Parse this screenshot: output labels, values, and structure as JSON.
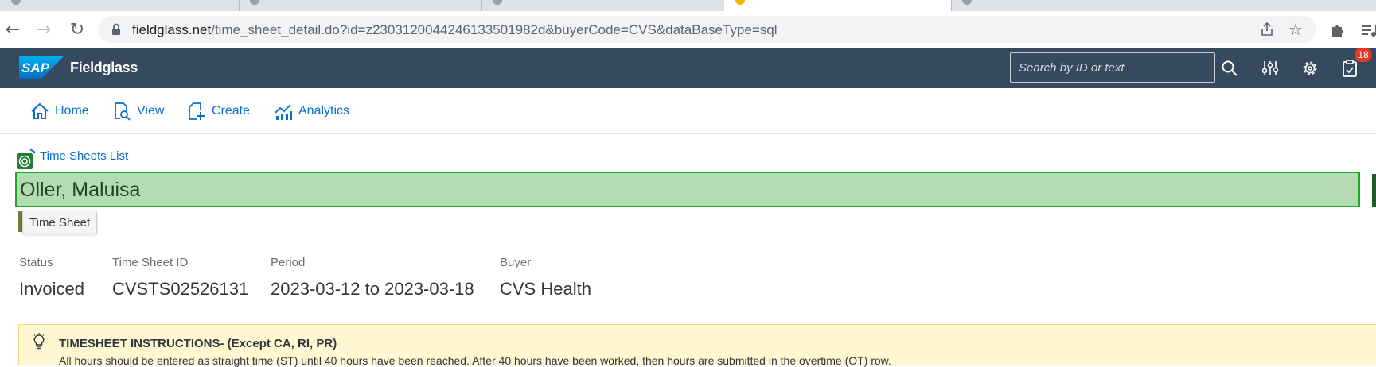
{
  "browser": {
    "url_host": "fieldglass.net",
    "url_path": "/time_sheet_detail.do?id=z2303120044246133501982d&buyerCode=CVS&dataBaseType=sql"
  },
  "shell": {
    "logo_text": "SAP",
    "product_name": "Fieldglass",
    "search_placeholder": "Search by ID or text",
    "notification_count": "18",
    "icons": [
      "search-icon",
      "filter-sliders-icon",
      "gear-icon",
      "clipboard-icon"
    ]
  },
  "nav": {
    "items": [
      {
        "label": "Home",
        "icon": "home-icon"
      },
      {
        "label": "View",
        "icon": "view-icon"
      },
      {
        "label": "Create",
        "icon": "create-icon"
      },
      {
        "label": "Analytics",
        "icon": "analytics-icon"
      }
    ]
  },
  "page": {
    "back_link": "Time Sheets List",
    "worker_name": "Oller, Maluisa",
    "tooltip": "Time Sheet",
    "fields": [
      {
        "label": "Status",
        "value": "Invoiced"
      },
      {
        "label": "Time Sheet ID",
        "value": "CVSTS02526131"
      },
      {
        "label": "Period",
        "value": "2023-03-12 to 2023-03-18"
      },
      {
        "label": "Buyer",
        "value": "CVS Health"
      }
    ],
    "instructions": {
      "title": "TIMESHEET INSTRUCTIONS- (Except CA, RI, PR)",
      "body": "All hours should be entered as straight time (ST) until 40 hours have been reached. After 40 hours have been worked, then hours are submitted in the overtime (OT) row."
    }
  },
  "colors": {
    "shell_bg": "#354a5f",
    "link_blue": "#0a6ed1",
    "highlight_green": "#b3dcb3",
    "instructions_bg": "#fef7d1",
    "badge_red": "#e9361f"
  }
}
